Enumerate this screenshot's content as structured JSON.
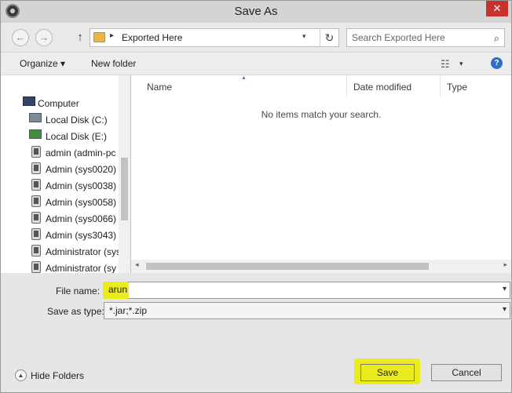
{
  "window": {
    "title": "Save As",
    "close_glyph": "✕"
  },
  "nav": {
    "back_glyph": "←",
    "forward_glyph": "→",
    "up_glyph": "↑",
    "address": {
      "separator": "▸",
      "path": "Exported Here",
      "dropdown_glyph": "▾",
      "refresh_glyph": "↻"
    },
    "search": {
      "placeholder": "Search Exported Here",
      "value": "",
      "icon_glyph": "⌕"
    }
  },
  "toolbar": {
    "organize_label": "Organize ▾",
    "new_folder_label": "New folder",
    "view_glyph": "☷",
    "view_drop_glyph": "▾",
    "help_glyph": "?"
  },
  "navpane": {
    "items": [
      {
        "label": "Computer",
        "icon": "computer-icon"
      },
      {
        "label": "Local Disk (C:)",
        "icon": "disk-icon"
      },
      {
        "label": "Local Disk (E:)",
        "icon": "disk-icon"
      },
      {
        "label": "admin (admin-pc",
        "icon": "user-folder-icon"
      },
      {
        "label": "Admin (sys0020)",
        "icon": "user-folder-icon"
      },
      {
        "label": "Admin (sys0038)",
        "icon": "user-folder-icon"
      },
      {
        "label": "Admin (sys0058)",
        "icon": "user-folder-icon"
      },
      {
        "label": "Admin (sys0066)",
        "icon": "user-folder-icon"
      },
      {
        "label": "Admin (sys3043)",
        "icon": "user-folder-icon"
      },
      {
        "label": "Administrator (sys",
        "icon": "user-folder-icon"
      },
      {
        "label": "Administrator (sy",
        "icon": "user-folder-icon"
      }
    ]
  },
  "content": {
    "sort_glyph": "▲",
    "columns": [
      {
        "label": "Name"
      },
      {
        "label": "Date modified"
      },
      {
        "label": "Type"
      }
    ],
    "empty_message": "No items match your search.",
    "scroll_left": "◂",
    "scroll_right": "▸"
  },
  "fields": {
    "file_name_label": "File name:",
    "file_name_value": "arun",
    "save_type_label": "Save as type:",
    "save_type_value": "*.jar;*.zip",
    "dropdown_glyph": "▾"
  },
  "footer": {
    "hide_folders_glyph": "▲",
    "hide_folders_label": "Hide Folders",
    "save_label": "Save",
    "cancel_label": "Cancel"
  },
  "colors": {
    "highlight": "#ecec1c",
    "close": "#c7322c",
    "help": "#2d6fc9"
  }
}
